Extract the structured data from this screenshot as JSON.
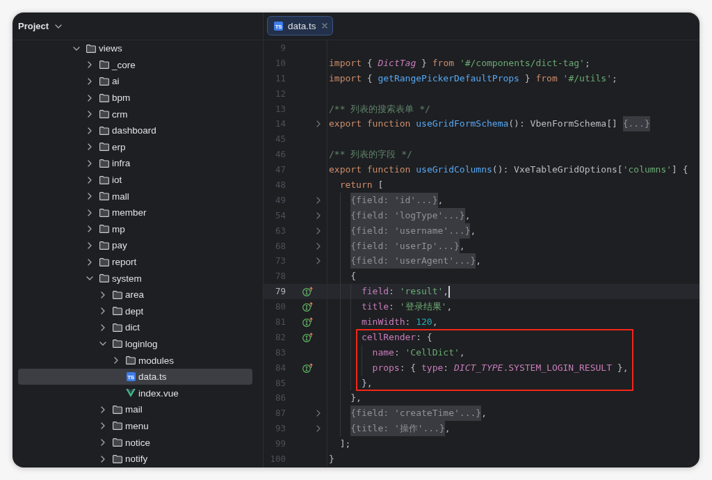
{
  "project_panel": {
    "title": "Project",
    "tree": [
      {
        "name": "views",
        "kind": "folder",
        "expanded": true,
        "selected": false,
        "children": [
          {
            "name": "_core",
            "kind": "folder",
            "expanded": false,
            "selected": false
          },
          {
            "name": "ai",
            "kind": "folder",
            "expanded": false,
            "selected": false
          },
          {
            "name": "bpm",
            "kind": "folder",
            "expanded": false,
            "selected": false
          },
          {
            "name": "crm",
            "kind": "folder",
            "expanded": false,
            "selected": false
          },
          {
            "name": "dashboard",
            "kind": "folder",
            "expanded": false,
            "selected": false
          },
          {
            "name": "erp",
            "kind": "folder",
            "expanded": false,
            "selected": false
          },
          {
            "name": "infra",
            "kind": "folder",
            "expanded": false,
            "selected": false
          },
          {
            "name": "iot",
            "kind": "folder",
            "expanded": false,
            "selected": false
          },
          {
            "name": "mall",
            "kind": "folder",
            "expanded": false,
            "selected": false
          },
          {
            "name": "member",
            "kind": "folder",
            "expanded": false,
            "selected": false
          },
          {
            "name": "mp",
            "kind": "folder",
            "expanded": false,
            "selected": false
          },
          {
            "name": "pay",
            "kind": "folder",
            "expanded": false,
            "selected": false
          },
          {
            "name": "report",
            "kind": "folder",
            "expanded": false,
            "selected": false
          },
          {
            "name": "system",
            "kind": "folder",
            "expanded": true,
            "selected": false,
            "children": [
              {
                "name": "area",
                "kind": "folder",
                "expanded": false,
                "selected": false
              },
              {
                "name": "dept",
                "kind": "folder",
                "expanded": false,
                "selected": false
              },
              {
                "name": "dict",
                "kind": "folder",
                "expanded": false,
                "selected": false
              },
              {
                "name": "loginlog",
                "kind": "folder",
                "expanded": true,
                "selected": false,
                "children": [
                  {
                    "name": "modules",
                    "kind": "folder",
                    "expanded": false,
                    "selected": false
                  },
                  {
                    "name": "data.ts",
                    "kind": "ts",
                    "badge": "TS",
                    "selected": true
                  },
                  {
                    "name": "index.vue",
                    "kind": "vue",
                    "selected": false
                  }
                ]
              },
              {
                "name": "mail",
                "kind": "folder",
                "expanded": false,
                "selected": false
              },
              {
                "name": "menu",
                "kind": "folder",
                "expanded": false,
                "selected": false
              },
              {
                "name": "notice",
                "kind": "folder",
                "expanded": false,
                "selected": false
              },
              {
                "name": "notify",
                "kind": "folder",
                "expanded": false,
                "selected": false
              }
            ]
          }
        ]
      }
    ]
  },
  "editor": {
    "tabs": [
      {
        "label": "data.ts",
        "badge": "TS",
        "selected": true
      }
    ],
    "lines": [
      {
        "number": "9",
        "folded": false,
        "marker": false,
        "current": false,
        "boxed": false
      },
      {
        "number": "10",
        "folded": false,
        "marker": false,
        "current": false,
        "boxed": false,
        "tokens": [
          {
            "text": "import",
            "kind": "keyword"
          },
          {
            "text": " { ",
            "kind": "plain"
          },
          {
            "text": "DictTag",
            "kind": "italic"
          },
          {
            "text": " } ",
            "kind": "plain"
          },
          {
            "text": "from ",
            "kind": "keyword"
          },
          {
            "text": "'#/components/dict-tag'",
            "kind": "string"
          },
          {
            "text": ";",
            "kind": "plain"
          }
        ]
      },
      {
        "number": "11",
        "folded": false,
        "marker": false,
        "current": false,
        "boxed": false,
        "tokens": [
          {
            "text": "import",
            "kind": "keyword"
          },
          {
            "text": " { ",
            "kind": "plain"
          },
          {
            "text": "getRangePickerDefaultProps",
            "kind": "function"
          },
          {
            "text": " } ",
            "kind": "plain"
          },
          {
            "text": "from ",
            "kind": "keyword"
          },
          {
            "text": "'#/utils'",
            "kind": "string"
          },
          {
            "text": ";",
            "kind": "plain"
          }
        ]
      },
      {
        "number": "12",
        "folded": false,
        "marker": false,
        "current": false,
        "boxed": false
      },
      {
        "number": "13",
        "folded": false,
        "marker": false,
        "current": false,
        "boxed": false,
        "tokens": [
          {
            "text": "/** 列表的搜索表单 */",
            "kind": "comment"
          }
        ]
      },
      {
        "number": "14",
        "folded": true,
        "marker": false,
        "current": false,
        "boxed": false,
        "tokens": [
          {
            "text": "export function ",
            "kind": "keyword"
          },
          {
            "text": "useGridFormSchema",
            "kind": "function"
          },
          {
            "text": "(): VbenFormSchema[] ",
            "kind": "plain"
          },
          {
            "text": "{...}",
            "kind": "fold"
          }
        ]
      },
      {
        "number": "45",
        "folded": false,
        "marker": false,
        "current": false,
        "boxed": false
      },
      {
        "number": "46",
        "folded": false,
        "marker": false,
        "current": false,
        "boxed": false,
        "tokens": [
          {
            "text": "/** 列表的字段 */",
            "kind": "comment"
          }
        ]
      },
      {
        "number": "47",
        "folded": false,
        "marker": false,
        "current": false,
        "boxed": false,
        "tokens": [
          {
            "text": "export function ",
            "kind": "keyword"
          },
          {
            "text": "useGridColumns",
            "kind": "function"
          },
          {
            "text": "(): VxeTableGridOptions[",
            "kind": "plain"
          },
          {
            "text": "'columns'",
            "kind": "string"
          },
          {
            "text": "] {",
            "kind": "plain"
          }
        ],
        "children": [
          {
            "number": "48",
            "folded": false,
            "marker": false,
            "current": false,
            "boxed": false,
            "tokens": [
              {
                "text": "return",
                "kind": "keyword"
              },
              {
                "text": " [",
                "kind": "plain"
              }
            ],
            "children": [
              {
                "number": "49",
                "folded": true,
                "marker": false,
                "current": false,
                "boxed": false,
                "tokens": [
                  {
                    "text": "{field: 'id'...}",
                    "kind": "fold"
                  },
                  {
                    "text": ",",
                    "kind": "plain"
                  }
                ]
              },
              {
                "number": "54",
                "folded": true,
                "marker": false,
                "current": false,
                "boxed": false,
                "tokens": [
                  {
                    "text": "{field: 'logType'...}",
                    "kind": "fold"
                  },
                  {
                    "text": ",",
                    "kind": "plain"
                  }
                ]
              },
              {
                "number": "63",
                "folded": true,
                "marker": false,
                "current": false,
                "boxed": false,
                "tokens": [
                  {
                    "text": "{field: 'username'...}",
                    "kind": "fold"
                  },
                  {
                    "text": ",",
                    "kind": "plain"
                  }
                ]
              },
              {
                "number": "68",
                "folded": true,
                "marker": false,
                "current": false,
                "boxed": false,
                "tokens": [
                  {
                    "text": "{field: 'userIp'...}",
                    "kind": "fold"
                  },
                  {
                    "text": ",",
                    "kind": "plain"
                  }
                ]
              },
              {
                "number": "73",
                "folded": true,
                "marker": false,
                "current": false,
                "boxed": false,
                "tokens": [
                  {
                    "text": "{field: 'userAgent'...}",
                    "kind": "fold"
                  },
                  {
                    "text": ",",
                    "kind": "plain"
                  }
                ]
              },
              {
                "number": "78",
                "folded": false,
                "marker": false,
                "current": false,
                "boxed": false,
                "tokens": [
                  {
                    "text": "{",
                    "kind": "plain"
                  }
                ],
                "children": [
                  {
                    "number": "79",
                    "folded": false,
                    "marker": true,
                    "current": true,
                    "boxed": false,
                    "tokens": [
                      {
                        "text": "field",
                        "kind": "property"
                      },
                      {
                        "text": ": ",
                        "kind": "plain"
                      },
                      {
                        "text": "'result'",
                        "kind": "string"
                      },
                      {
                        "text": ",",
                        "kind": "plain"
                      }
                    ]
                  },
                  {
                    "number": "80",
                    "folded": false,
                    "marker": true,
                    "current": false,
                    "boxed": false,
                    "tokens": [
                      {
                        "text": "title",
                        "kind": "property"
                      },
                      {
                        "text": ": ",
                        "kind": "plain"
                      },
                      {
                        "text": "'登录结果'",
                        "kind": "string"
                      },
                      {
                        "text": ",",
                        "kind": "plain"
                      }
                    ]
                  },
                  {
                    "number": "81",
                    "folded": false,
                    "marker": true,
                    "current": false,
                    "boxed": false,
                    "tokens": [
                      {
                        "text": "minWidth",
                        "kind": "property"
                      },
                      {
                        "text": ": ",
                        "kind": "plain"
                      },
                      {
                        "text": "120",
                        "kind": "number"
                      },
                      {
                        "text": ",",
                        "kind": "plain"
                      }
                    ]
                  },
                  {
                    "number": "82",
                    "folded": false,
                    "marker": true,
                    "current": false,
                    "boxed": true,
                    "tokens": [
                      {
                        "text": "cellRender",
                        "kind": "property"
                      },
                      {
                        "text": ": {",
                        "kind": "plain"
                      }
                    ],
                    "children": [
                      {
                        "number": "83",
                        "folded": false,
                        "marker": false,
                        "current": false,
                        "boxed": true,
                        "tokens": [
                          {
                            "text": "name",
                            "kind": "property"
                          },
                          {
                            "text": ": ",
                            "kind": "plain"
                          },
                          {
                            "text": "'CellDict'",
                            "kind": "string"
                          },
                          {
                            "text": ",",
                            "kind": "plain"
                          }
                        ]
                      },
                      {
                        "number": "84",
                        "folded": false,
                        "marker": true,
                        "current": false,
                        "boxed": true,
                        "tokens": [
                          {
                            "text": "props",
                            "kind": "property"
                          },
                          {
                            "text": ": { ",
                            "kind": "plain"
                          },
                          {
                            "text": "type",
                            "kind": "property"
                          },
                          {
                            "text": ": ",
                            "kind": "plain"
                          },
                          {
                            "text": "DICT_TYPE",
                            "kind": "italic"
                          },
                          {
                            "text": ".SYSTEM_LOGIN_RESULT",
                            "kind": "property"
                          },
                          {
                            "text": " },",
                            "kind": "plain"
                          }
                        ]
                      }
                    ]
                  },
                  {
                    "number": "85",
                    "folded": false,
                    "marker": false,
                    "current": false,
                    "boxed": true,
                    "tokens": [
                      {
                        "text": "},",
                        "kind": "plain"
                      }
                    ]
                  }
                ]
              },
              {
                "number": "86",
                "folded": false,
                "marker": false,
                "current": false,
                "boxed": false,
                "tokens": [
                  {
                    "text": "},",
                    "kind": "plain"
                  }
                ]
              },
              {
                "number": "87",
                "folded": true,
                "marker": false,
                "current": false,
                "boxed": false,
                "tokens": [
                  {
                    "text": "{field: 'createTime'...}",
                    "kind": "fold"
                  },
                  {
                    "text": ",",
                    "kind": "plain"
                  }
                ]
              },
              {
                "number": "93",
                "folded": true,
                "marker": false,
                "current": false,
                "boxed": false,
                "tokens": [
                  {
                    "text": "{title: '操作'...}",
                    "kind": "fold"
                  },
                  {
                    "text": ",",
                    "kind": "plain"
                  }
                ]
              }
            ]
          },
          {
            "number": "99",
            "folded": false,
            "marker": false,
            "current": false,
            "boxed": false,
            "tokens": [
              {
                "text": "];",
                "kind": "plain"
              }
            ]
          }
        ]
      },
      {
        "number": "100",
        "folded": false,
        "marker": false,
        "current": false,
        "boxed": false,
        "tokens": [
          {
            "text": "}",
            "kind": "plain"
          }
        ]
      }
    ]
  }
}
